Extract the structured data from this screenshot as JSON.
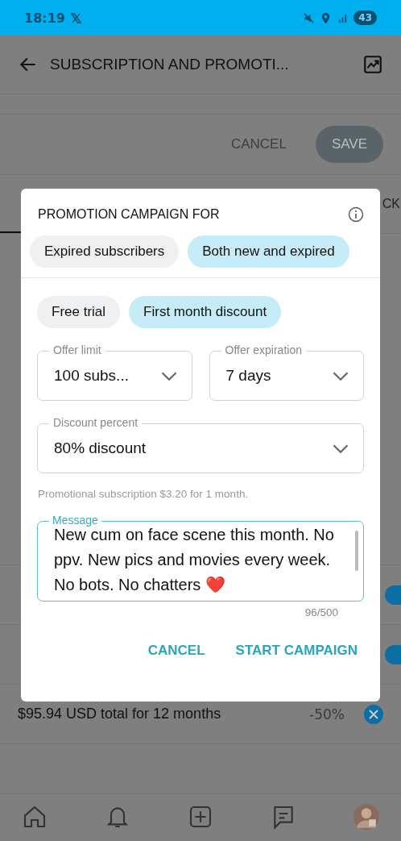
{
  "status_bar": {
    "time": "18:19",
    "battery": "43"
  },
  "app_bar": {
    "title": "SUBSCRIPTION AND PROMOTI..."
  },
  "form_actions": {
    "cancel": "CANCEL",
    "save": "SAVE"
  },
  "tab_fragment": "CK",
  "bundle_rows": [
    {
      "on": true
    },
    {
      "on": true
    }
  ],
  "bundle_total": {
    "text": "$95.94 USD total for 12 months",
    "discount": "-50%"
  },
  "dialog": {
    "title": "PROMOTION CAMPAIGN FOR",
    "audience": [
      {
        "label": "Expired subscribers",
        "selected": false
      },
      {
        "label": "Both new and expired",
        "selected": true
      }
    ],
    "offer_type": [
      {
        "label": "Free trial",
        "selected": false
      },
      {
        "label": "First month discount",
        "selected": true
      }
    ],
    "offer_limit": {
      "label": "Offer limit",
      "value": "100 subs..."
    },
    "offer_expiration": {
      "label": "Offer expiration",
      "value": "7 days"
    },
    "discount_percent": {
      "label": "Discount percent",
      "value": "80% discount"
    },
    "hint": "Promotional subscription $3.20 for 1 month.",
    "message": {
      "label": "Message",
      "value": "New cum on face scene this month. No ppv. New pics and movies every week. No bots. No chatters ❤️",
      "counter": "96/500"
    },
    "buttons": [
      "CANCEL",
      "START CAMPAIGN"
    ]
  }
}
